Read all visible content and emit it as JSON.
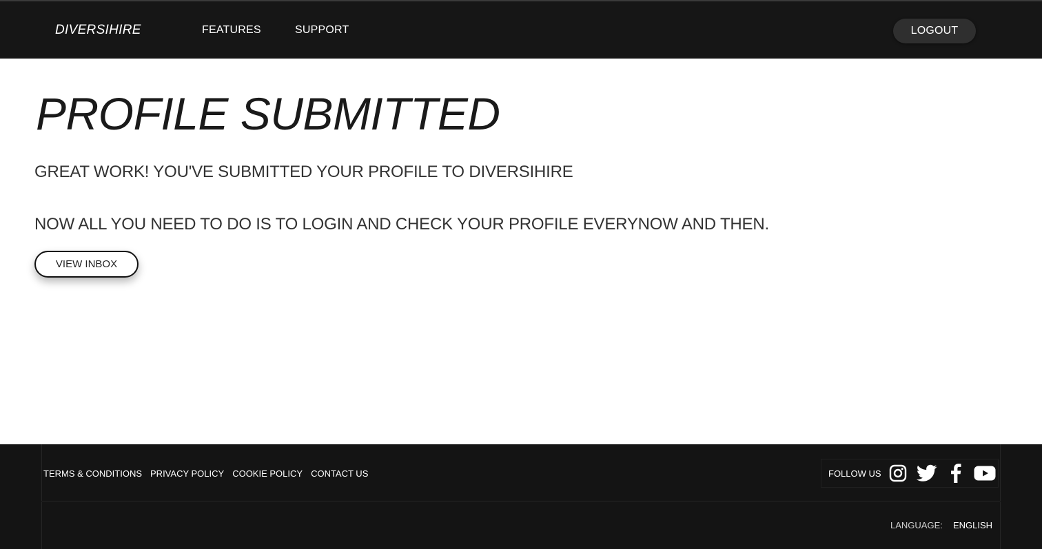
{
  "header": {
    "brand": "DIVERSIHIRE",
    "nav": {
      "features": "FEATURES",
      "support": "SUPPORT"
    },
    "logout_label": "LOGOUT"
  },
  "main": {
    "title": "PROFILE SUBMITTED",
    "line1": "GREAT WORK! YOU'VE SUBMITTED YOUR PROFILE TO DIVERSIHIRE",
    "line2": "NOW ALL YOU NEED TO DO IS TO LOGIN AND CHECK YOUR PROFILE EVERYNOW AND THEN.",
    "inbox_button": "VIEW INBOX"
  },
  "footer": {
    "links": [
      "TERMS & CONDITIONS",
      "PRIVACY POLICY",
      "COOKIE POLICY",
      "CONTACT US"
    ],
    "follow_label": "FOLLOW US",
    "social_icons": [
      "instagram-icon",
      "twitter-icon",
      "facebook-icon",
      "youtube-icon"
    ],
    "language_label": "LANGUAGE:",
    "language_value": "ENGLISH"
  },
  "colors": {
    "header_bg": "#161616",
    "footer_bg": "#141414",
    "text_dark": "#1a1a1a",
    "button_dark": "#2f2f2f"
  }
}
